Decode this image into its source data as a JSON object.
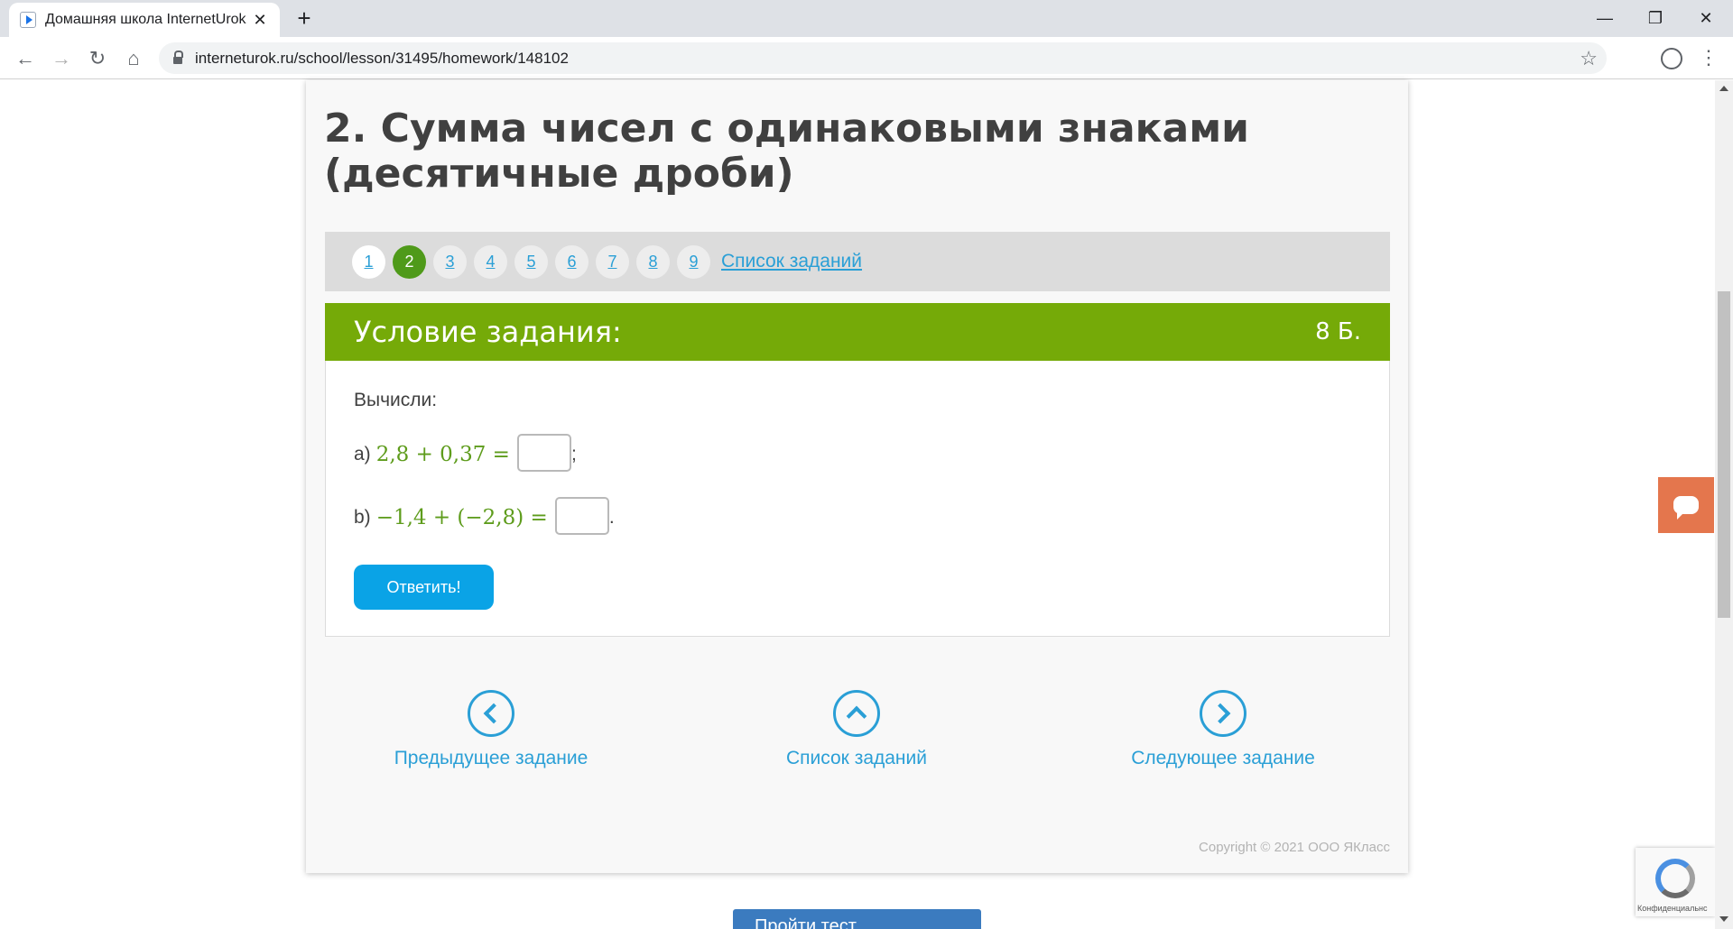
{
  "browser": {
    "tab_title": "Домашняя школа InternetUrok.r",
    "url": "interneturok.ru/school/lesson/31495/homework/148102",
    "new_tab_symbol": "+",
    "tab_close_symbol": "✕",
    "minimize_symbol": "—",
    "maximize_symbol": "❐",
    "close_symbol": "✕",
    "back_symbol": "←",
    "forward_symbol": "→",
    "reload_symbol": "↻",
    "home_symbol": "⌂",
    "star_symbol": "☆",
    "menu_symbol": "⋮"
  },
  "lesson": {
    "title": "2. Сумма чисел с одинаковыми знаками (десятичные дроби)"
  },
  "task_nav": {
    "numbers": [
      "1",
      "2",
      "3",
      "4",
      "5",
      "6",
      "7",
      "8",
      "9"
    ],
    "active": "2",
    "list_link": "Список заданий"
  },
  "task": {
    "header_title": "Условие задания:",
    "score": "8 Б.",
    "prompt": "Вычисли:",
    "part_a": {
      "label": "a)",
      "expression": "2,8 + 0,37 =",
      "suffix": ";"
    },
    "part_b": {
      "label": "b)",
      "expression": "−1,4 + (−2,8) =",
      "suffix": "."
    },
    "submit_label": "Ответить!"
  },
  "bottom_nav": {
    "prev_label": "Предыдущее задание",
    "list_label": "Список заданий",
    "next_label": "Следующее задание"
  },
  "footer": {
    "copyright": "Copyright © 2021 ООО ЯКласс",
    "recaptcha_text": "Конфиденциальнс",
    "bottom_button": "Пройти тест"
  },
  "colors": {
    "accent_green": "#75aa08",
    "active_circle": "#4f9a1a",
    "link_blue": "#2a9fd6",
    "button_blue": "#0aa3e6",
    "chat_orange": "#e4764d"
  }
}
